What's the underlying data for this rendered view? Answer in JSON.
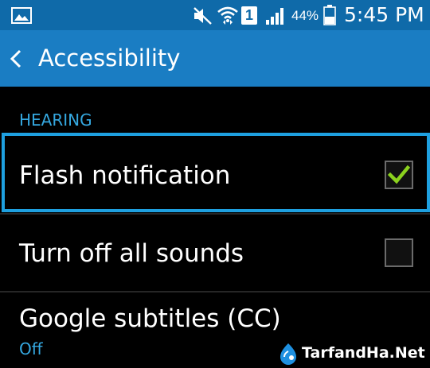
{
  "status_bar": {
    "battery_percent": "44%",
    "time": "5:45 PM",
    "sim_slot": "1",
    "icons": [
      "gallery-icon",
      "mute-icon",
      "wifi-icon",
      "sim-icon",
      "signal-icon",
      "battery-icon"
    ],
    "battery_level": 0.44
  },
  "action_bar": {
    "title": "Accessibility",
    "back_icon": "chevron-left-icon"
  },
  "section": {
    "header": "HEARING"
  },
  "settings": [
    {
      "label": "Flash notification",
      "checked": true,
      "focused": true
    },
    {
      "label": "Turn off all sounds",
      "checked": false
    },
    {
      "label": "Google subtitles (CC)",
      "summary": "Off"
    }
  ],
  "watermark": {
    "text": "TarfandHa.Net"
  },
  "colors": {
    "status_bar_bg": "#0f6aa9",
    "action_bar_bg": "#1a7dc3",
    "accent_blue": "#35a8e0",
    "focus_border": "#1ea0e0",
    "checkmark_green": "#8bd11e",
    "background": "#000000"
  }
}
